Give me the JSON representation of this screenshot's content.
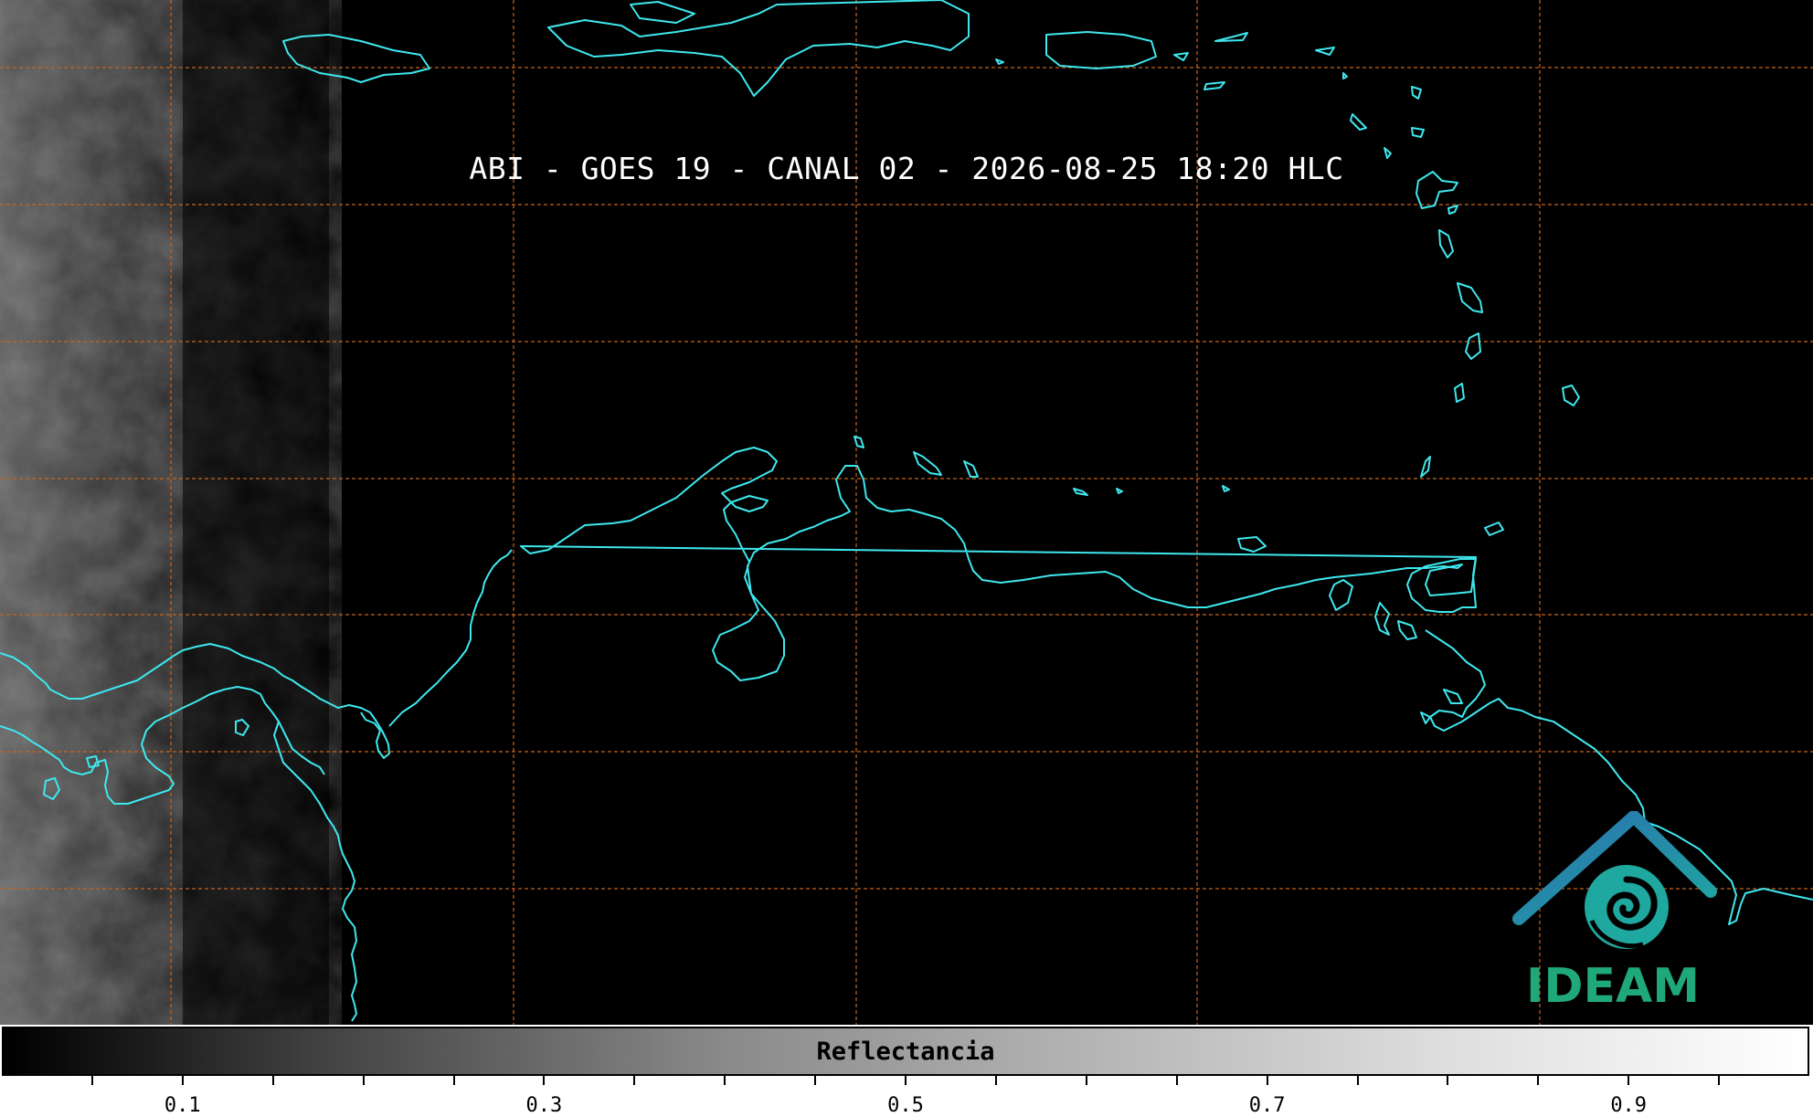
{
  "title": "ABI - GOES 19 - CANAL 02 - 2026-08-25 18:20 HLC",
  "colorbar": {
    "label": "Reflectancia",
    "tick_labels": [
      "0.1",
      "0.3",
      "0.5",
      "0.7",
      "0.9"
    ],
    "range": [
      0,
      1
    ]
  },
  "logo": {
    "text": "IDEAM"
  },
  "colors": {
    "coastline": "#3ee8ee",
    "gridline": "#c8641e",
    "logo_blue": "#2a6fb0",
    "logo_teal": "#1fa8a0",
    "logo_green": "#1fa87a"
  }
}
